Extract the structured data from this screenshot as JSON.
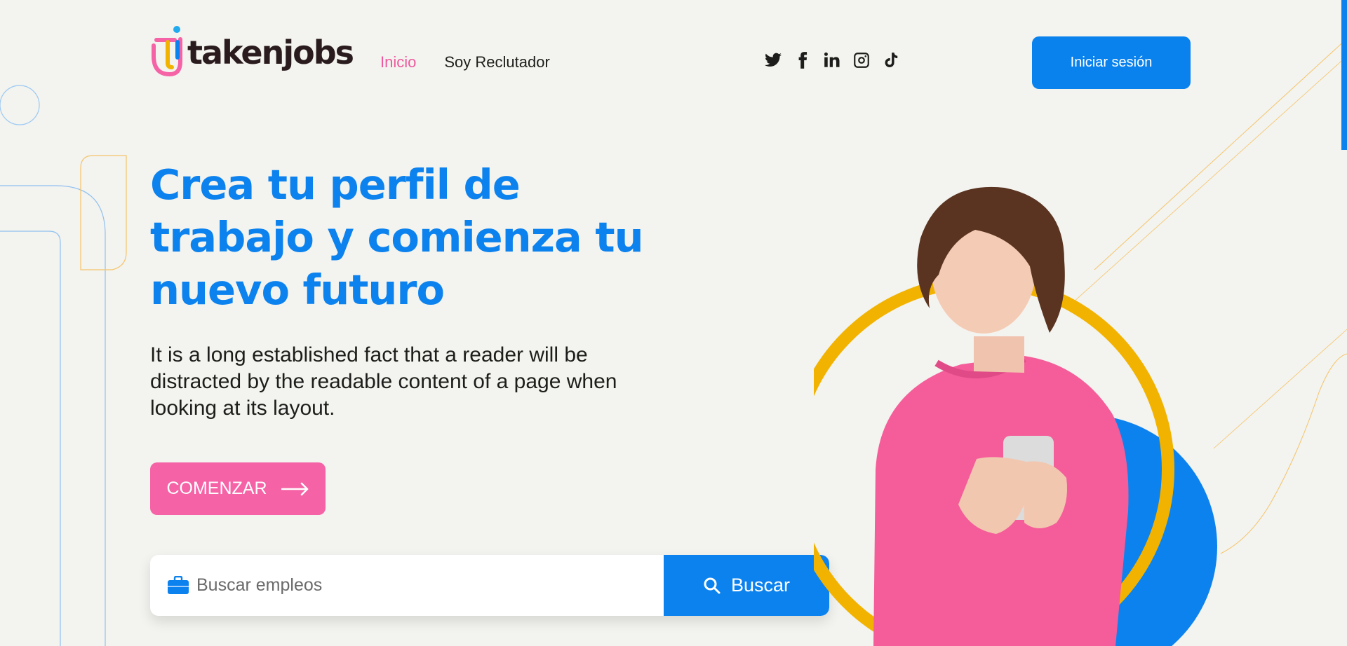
{
  "brand": {
    "name": "takenjobs"
  },
  "nav": {
    "items": [
      {
        "label": "Inicio",
        "active": true
      },
      {
        "label": "Soy Reclutador",
        "active": false
      }
    ]
  },
  "social": {
    "icons": [
      "twitter-icon",
      "facebook-icon",
      "linkedin-icon",
      "instagram-icon",
      "tiktok-icon"
    ]
  },
  "header": {
    "login_label": "Iniciar sesión"
  },
  "hero": {
    "title": "Crea tu perfil de trabajo y comienza tu nuevo futuro",
    "text": "It is a long established fact that a reader will be distracted by the readable content of a page when looking at its layout.",
    "cta_label": "COMENZAR"
  },
  "search": {
    "placeholder": "Buscar empleos",
    "button_label": "Buscar"
  },
  "colors": {
    "primary": "#0c82ee",
    "accent": "#f562a6",
    "nav_active": "#ee5a9d",
    "ring": "#f2b300",
    "background": "#f3f3ef"
  }
}
